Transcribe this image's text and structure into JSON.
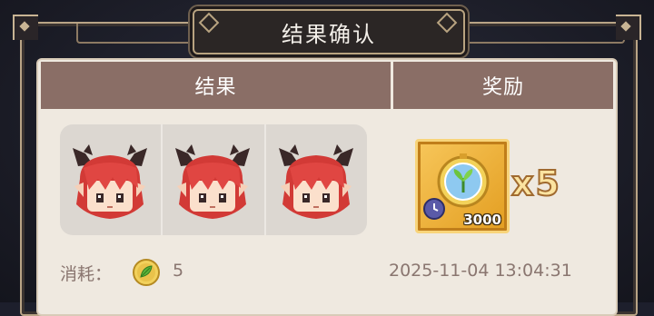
{
  "dialog": {
    "title": "结果确认"
  },
  "table": {
    "result_header": "结果",
    "reward_header": "奖励"
  },
  "result": {
    "characters": [
      {
        "name": "red-haired-horned-character"
      },
      {
        "name": "red-haired-horned-character"
      },
      {
        "name": "red-haired-horned-character"
      }
    ]
  },
  "reward": {
    "icon": "golden-stopwatch-sprout-icon",
    "quantity_badge": "3000",
    "multiplier": "x5"
  },
  "footer": {
    "cost_label": "消耗：",
    "cost_icon": "green-leaf-coin-icon",
    "cost_value": "5",
    "timestamp": "2025-11-04 13:04:31"
  },
  "colors": {
    "header_bg": "#8a6e66",
    "panel_bg": "#efe9e0",
    "reward_gold": "#f0b43c"
  }
}
